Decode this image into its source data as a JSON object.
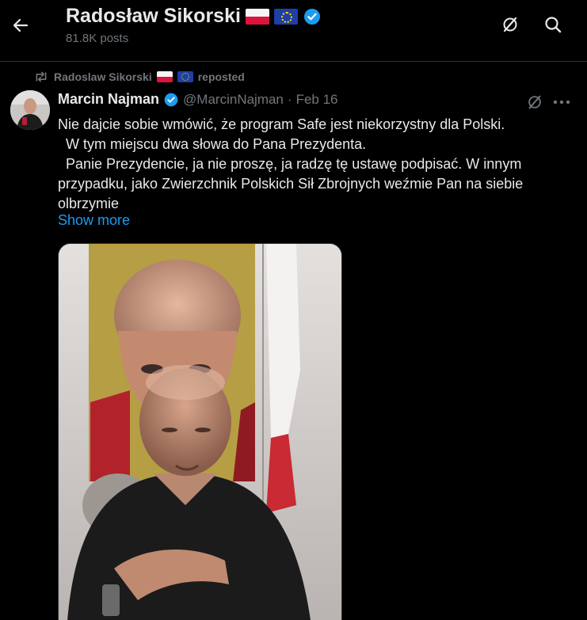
{
  "header": {
    "name": "Radosław Sikorski",
    "posts_count": "81.8K posts"
  },
  "repost": {
    "reposter_name": "Radoslaw Sikorski",
    "action": "reposted"
  },
  "post": {
    "author_name": "Marcin Najman",
    "author_handle": "@MarcinNajman",
    "separator": "·",
    "date": "Feb 16",
    "text": "Nie dajcie sobie wmówić, że program Safe jest niekorzystny dla Polski.\n  W tym miejscu dwa słowa do Pana Prezydenta.\n  Panie Prezydencie, ja nie proszę, ja radzę tę ustawę podpisać. W innym przypadku, jako Zwierzchnik Polskich Sił Zbrojnych weźmie Pan na siebie olbrzymie",
    "show_more_label": "Show more"
  },
  "icons": {
    "back": "arrow-left-icon",
    "grok": "grok-icon",
    "search": "search-icon",
    "more": "more-horizontal-icon",
    "verified": "verified-badge-icon",
    "repost": "repost-icon"
  },
  "colors": {
    "background": "#000000",
    "text_primary": "#e7e9ea",
    "text_secondary": "#71767b",
    "link": "#1d9bf0",
    "verified": "#1d9bf0"
  }
}
